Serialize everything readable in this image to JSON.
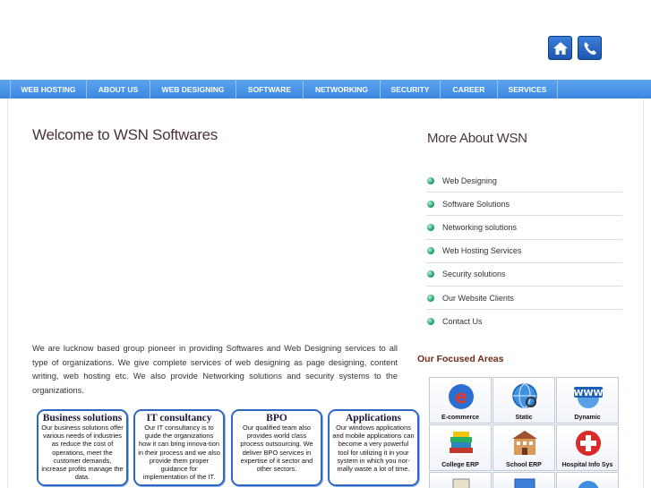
{
  "header": {
    "icons": [
      "home-icon",
      "phone-icon"
    ]
  },
  "nav": {
    "items": [
      {
        "label": "WEB HOSTING"
      },
      {
        "label": "ABOUT US"
      },
      {
        "label": "WEB DESIGNING"
      },
      {
        "label": "SOFTWARE"
      },
      {
        "label": "NETWORKING"
      },
      {
        "label": "SECURITY"
      },
      {
        "label": "CAREER"
      },
      {
        "label": "SERVICES"
      }
    ]
  },
  "main": {
    "welcome_title": "Welcome to WSN Softwares",
    "intro": "We are lucknow based group pioneer in providing Softwares and Web Designing services to all type of organizations. We give complete services of web designing as page designing, content writing, web hosting etc. We also provide Networking solutions and security systems to the organizations.",
    "boxes": [
      {
        "title": "Business solutions",
        "text": "Our business solutions offer various needs of industries as reduce the cost of operations, meet the customer demands, increase profits manage the data."
      },
      {
        "title": "IT consultancy",
        "text": "Our IT consultancy is to guide the organizations how it can bring innova-tion in their process and we also provide them proper guidance for implementation of the IT."
      },
      {
        "title": "BPO",
        "text": "Our qualified team also provides world class process outsourcing. We deliver BPO services in expertise of it sector and other sectors."
      },
      {
        "title": "Applications",
        "text": "Our windows applications and mobile applications can become a very powerful tool for utilizing it in your system in which you nor-mally waste a lot of time."
      }
    ]
  },
  "sidebar": {
    "more_title": "More About WSN",
    "links": [
      {
        "label": "Web Designing"
      },
      {
        "label": "Software Solutions"
      },
      {
        "label": "Networking solutions"
      },
      {
        "label": "Web Hosting Services"
      },
      {
        "label": "Security solutions"
      },
      {
        "label": "Our Website Clients"
      },
      {
        "label": "Contact Us"
      }
    ],
    "focused_title": "Our Focused Areas",
    "focused": [
      {
        "label": "E-commerce",
        "icon": "ecommerce-icon"
      },
      {
        "label": "Static",
        "icon": "globe-icon"
      },
      {
        "label": "Dynamic",
        "icon": "www-icon"
      },
      {
        "label": "College ERP",
        "icon": "books-icon"
      },
      {
        "label": "School ERP",
        "icon": "school-building-icon"
      },
      {
        "label": "Hospital Info Sys",
        "icon": "red-cross-icon"
      }
    ]
  },
  "colors": {
    "nav": "#3b86e0",
    "box_border": "#2f67c7",
    "focused_title": "#6e2b1b"
  }
}
